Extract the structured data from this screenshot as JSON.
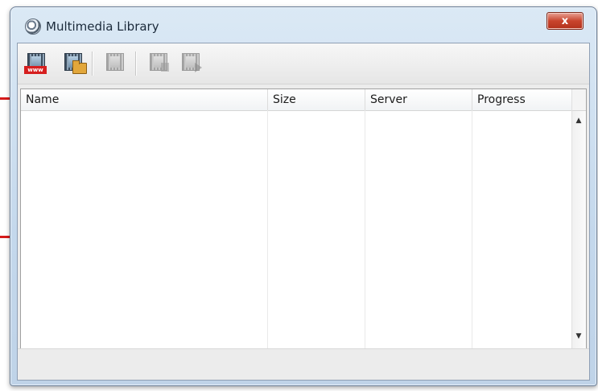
{
  "window": {
    "title": "Multimedia Library",
    "close_label": "x"
  },
  "toolbar": {
    "buttons": [
      {
        "icon": "film-www-icon",
        "enabled": true
      },
      {
        "icon": "film-folder-icon",
        "enabled": true
      },
      {
        "icon": "film-delete-icon",
        "enabled": false
      },
      {
        "icon": "film-export-icon",
        "enabled": false
      },
      {
        "icon": "film-play-icon",
        "enabled": false
      }
    ],
    "www_text": "www"
  },
  "list": {
    "columns": [
      "Name",
      "Size",
      "Server",
      "Progress"
    ],
    "rows": []
  },
  "scroll": {
    "up": "▲",
    "down": "▼"
  },
  "colors": {
    "accent": "#d61a1a",
    "close_button": "#c8442d"
  }
}
